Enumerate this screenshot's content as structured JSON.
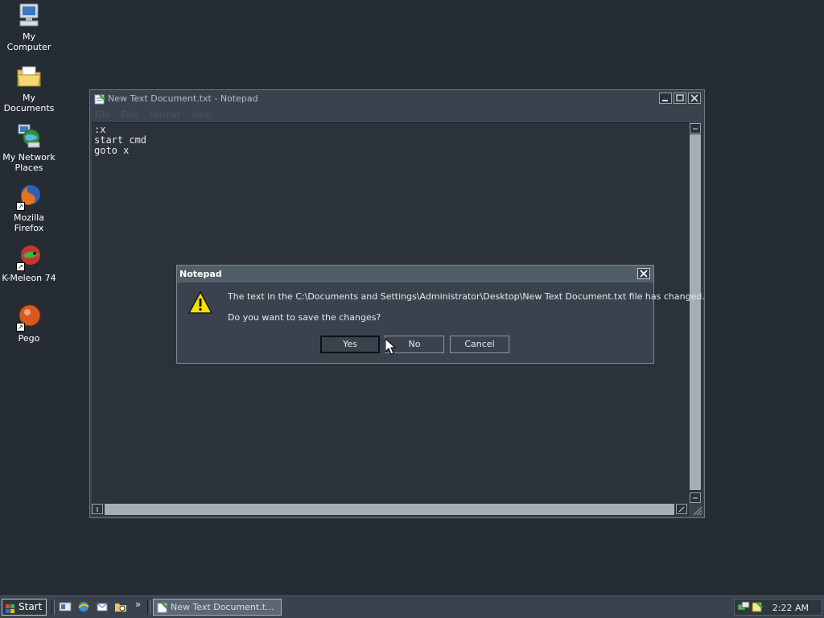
{
  "desktop": {
    "icons": [
      {
        "label": "My Computer"
      },
      {
        "label": "My Documents"
      },
      {
        "label": "My Network Places"
      },
      {
        "label": "Mozilla Firefox"
      },
      {
        "label": "K-Meleon 74"
      },
      {
        "label": "Pego"
      }
    ]
  },
  "notepad": {
    "title": "New Text Document.txt - Notepad",
    "menu": [
      "File",
      "Edit",
      "Format",
      "Help"
    ],
    "content": ":x\nstart cmd\ngoto x"
  },
  "dialog": {
    "title": "Notepad",
    "message_line1": "The text in the C:\\Documents and Settings\\Administrator\\Desktop\\New Text Document.txt file has changed.",
    "message_line2": "Do you want to save the changes?",
    "buttons": {
      "yes": "Yes",
      "no": "No",
      "cancel": "Cancel"
    }
  },
  "taskbar": {
    "start_label": "Start",
    "task_label": "New Text Document.t...",
    "clock": "2:22 AM",
    "overflow": "»"
  },
  "colors": {
    "desktop_bg": "#252c34",
    "window_bg": "#3a434d",
    "dialog_title_bg": "#515d69",
    "warning_yellow": "#f2e400"
  }
}
